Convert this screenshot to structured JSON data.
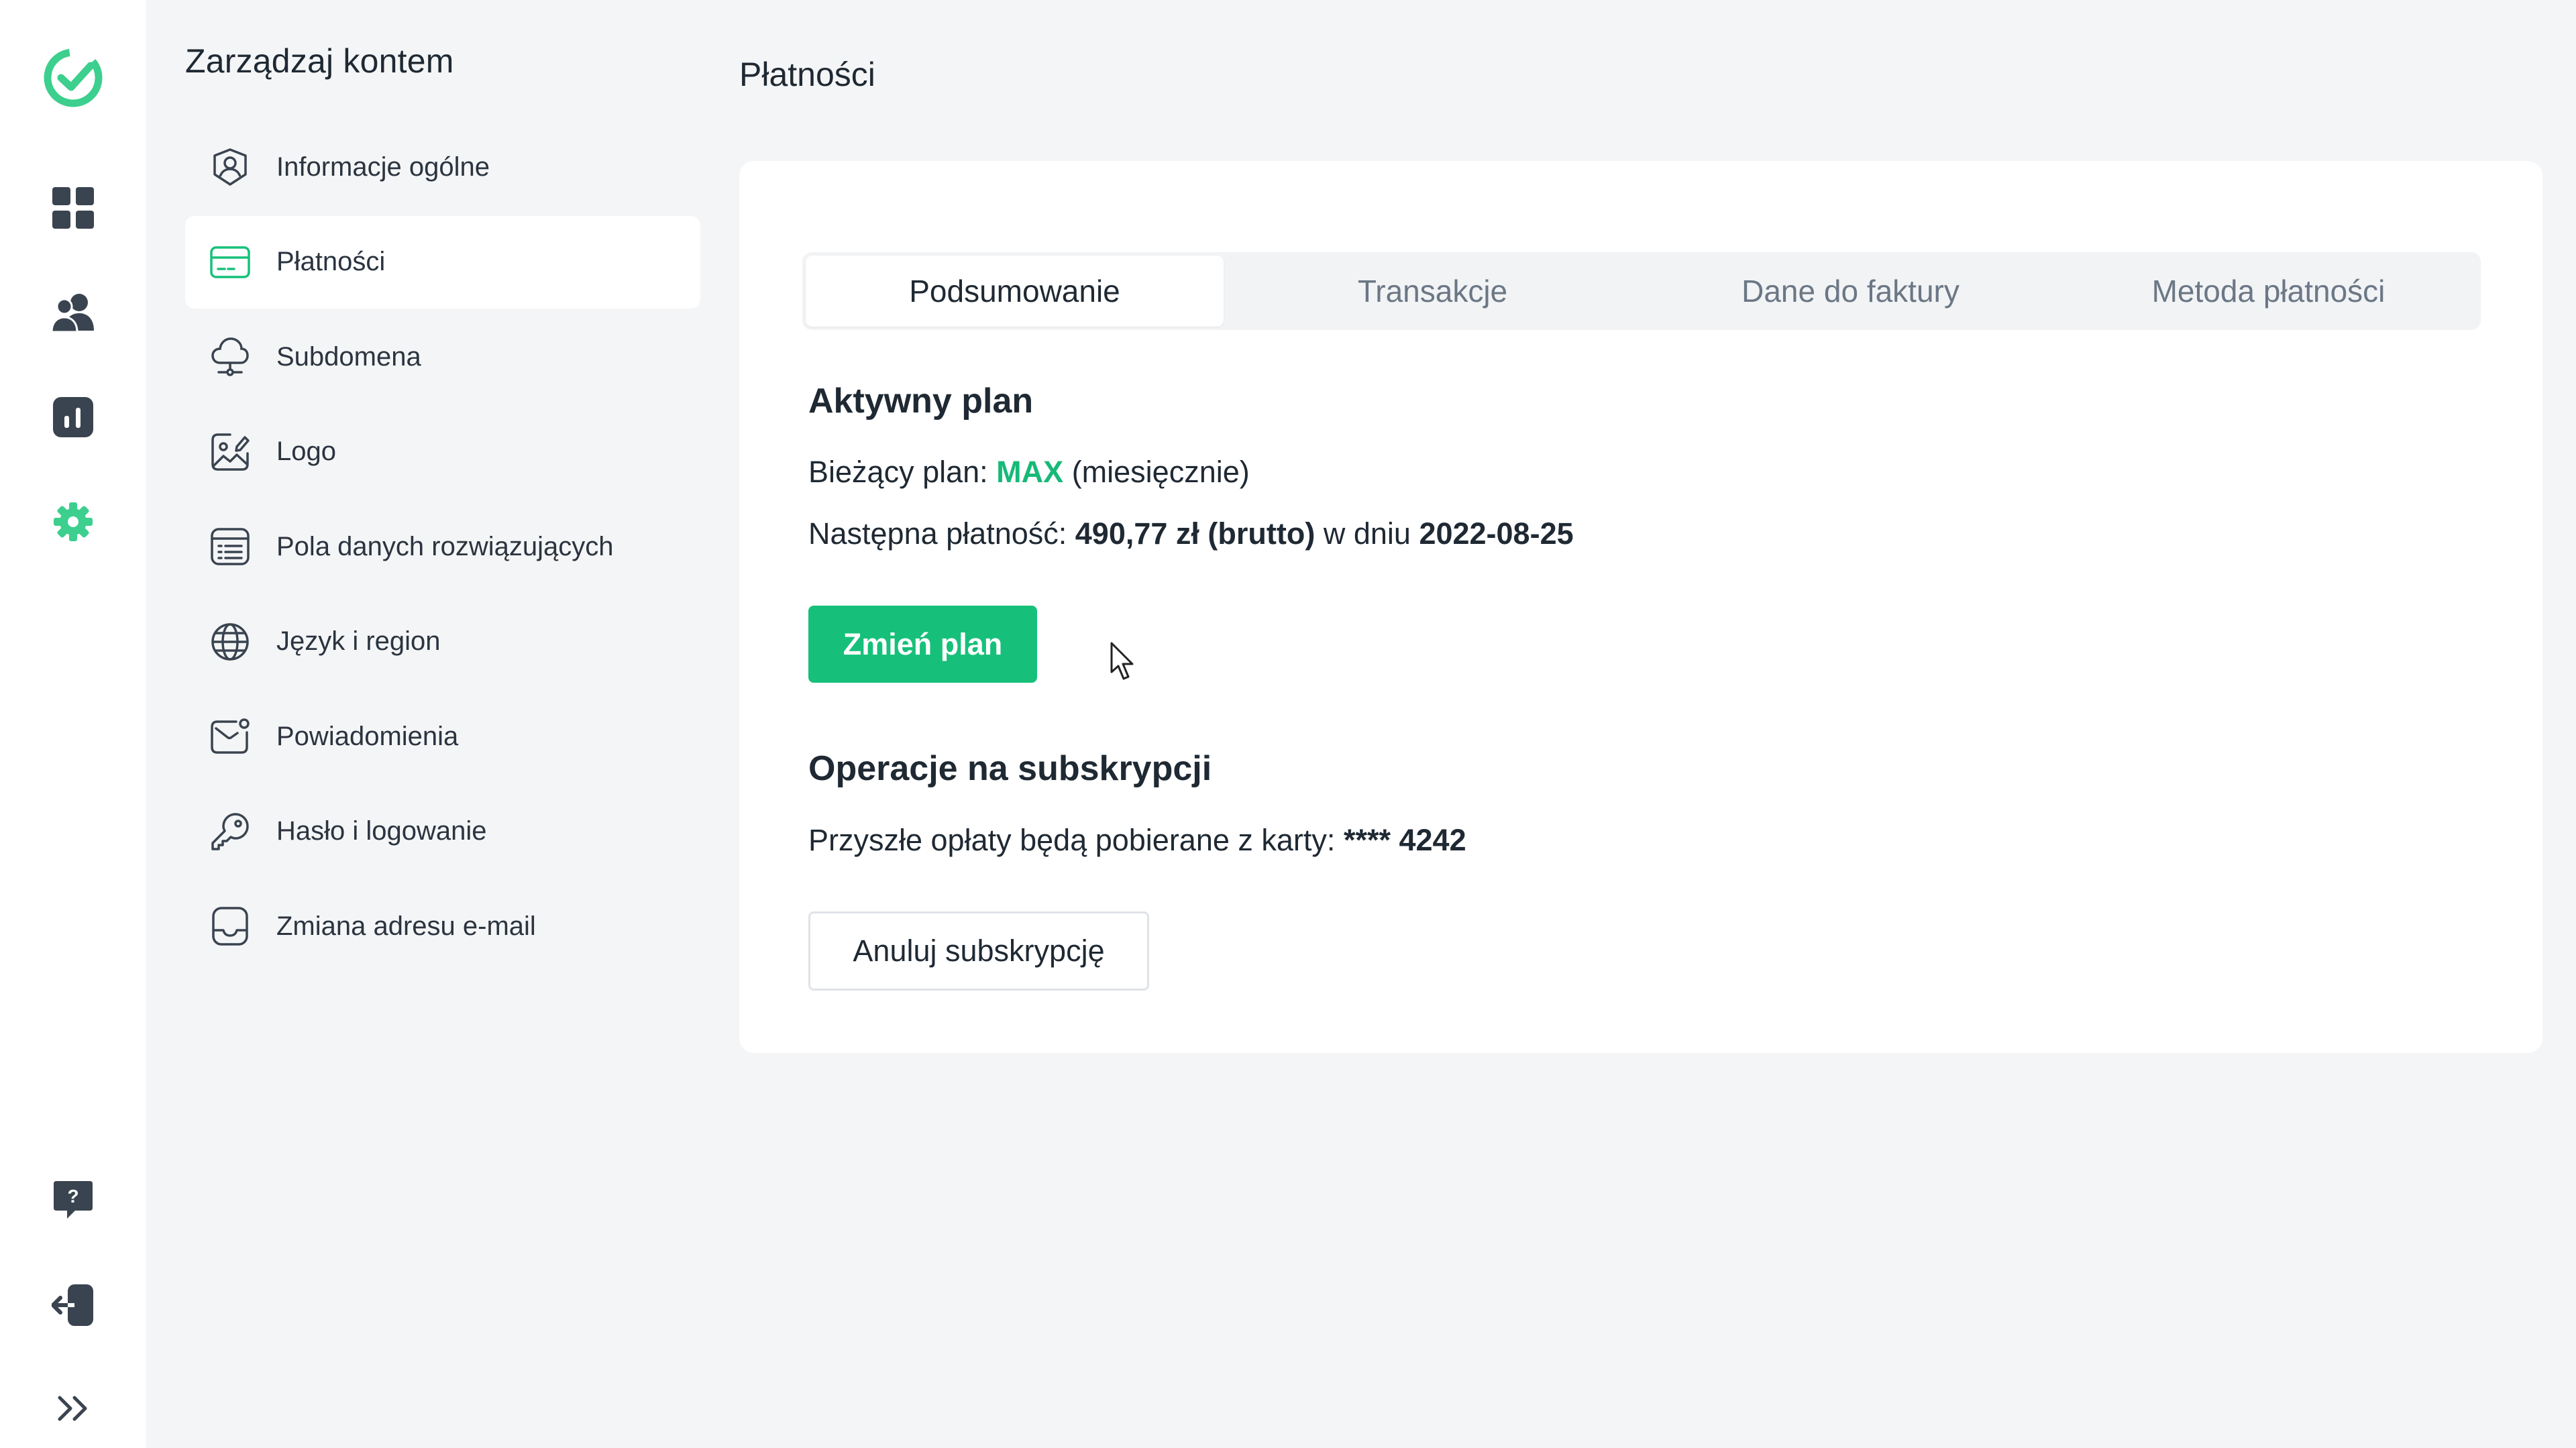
{
  "colors": {
    "brand_green": "#17c07a",
    "plan_green": "#17b978",
    "rail_icon": "#3a4450",
    "rail_active_icon": "#3ccf8e"
  },
  "rail": {
    "logo_icon": "check-circle-logo-icon",
    "items": [
      {
        "icon": "dashboard-grid-icon"
      },
      {
        "icon": "users-icon"
      },
      {
        "icon": "bar-chart-icon"
      },
      {
        "icon": "gear-icon",
        "active": true
      }
    ],
    "bottom": [
      {
        "icon": "help-chat-icon"
      },
      {
        "icon": "logout-icon"
      },
      {
        "icon": "chevrons-right-icon"
      }
    ]
  },
  "menu": {
    "title": "Zarządzaj kontem",
    "items": [
      {
        "label": "Informacje ogólne",
        "icon": "user-circle-icon"
      },
      {
        "label": "Płatności",
        "icon": "credit-card-icon",
        "active": true
      },
      {
        "label": "Subdomena",
        "icon": "cloud-network-icon"
      },
      {
        "label": "Logo",
        "icon": "image-edit-icon"
      },
      {
        "label": "Pola danych rozwiązujących",
        "icon": "form-fields-icon"
      },
      {
        "label": "Język i region",
        "icon": "globe-icon"
      },
      {
        "label": "Powiadomienia",
        "icon": "mail-notification-icon"
      },
      {
        "label": "Hasło i logowanie",
        "icon": "key-icon"
      },
      {
        "label": "Zmiana adresu e-mail",
        "icon": "inbox-icon"
      }
    ]
  },
  "page": {
    "title": "Płatności",
    "tabs": [
      {
        "label": "Podsumowanie",
        "active": true
      },
      {
        "label": "Transakcje"
      },
      {
        "label": "Dane do faktury"
      },
      {
        "label": "Metoda płatności"
      }
    ],
    "active_plan": {
      "heading": "Aktywny plan",
      "current_plan_label": "Bieżący plan:",
      "plan_name": "MAX",
      "plan_period": "(miesięcznie)",
      "next_payment_label": "Następna płatność:",
      "next_payment_amount": "490,77 zł (brutto)",
      "date_connector": "w dniu",
      "next_payment_date": "2022-08-25",
      "change_plan_button": "Zmień plan"
    },
    "subscription": {
      "heading": "Operacje na subskrypcji",
      "card_info_label": "Przyszłe opłaty będą pobierane z karty:",
      "card_number_masked": "**** 4242",
      "cancel_button": "Anuluj subskrypcję"
    }
  }
}
